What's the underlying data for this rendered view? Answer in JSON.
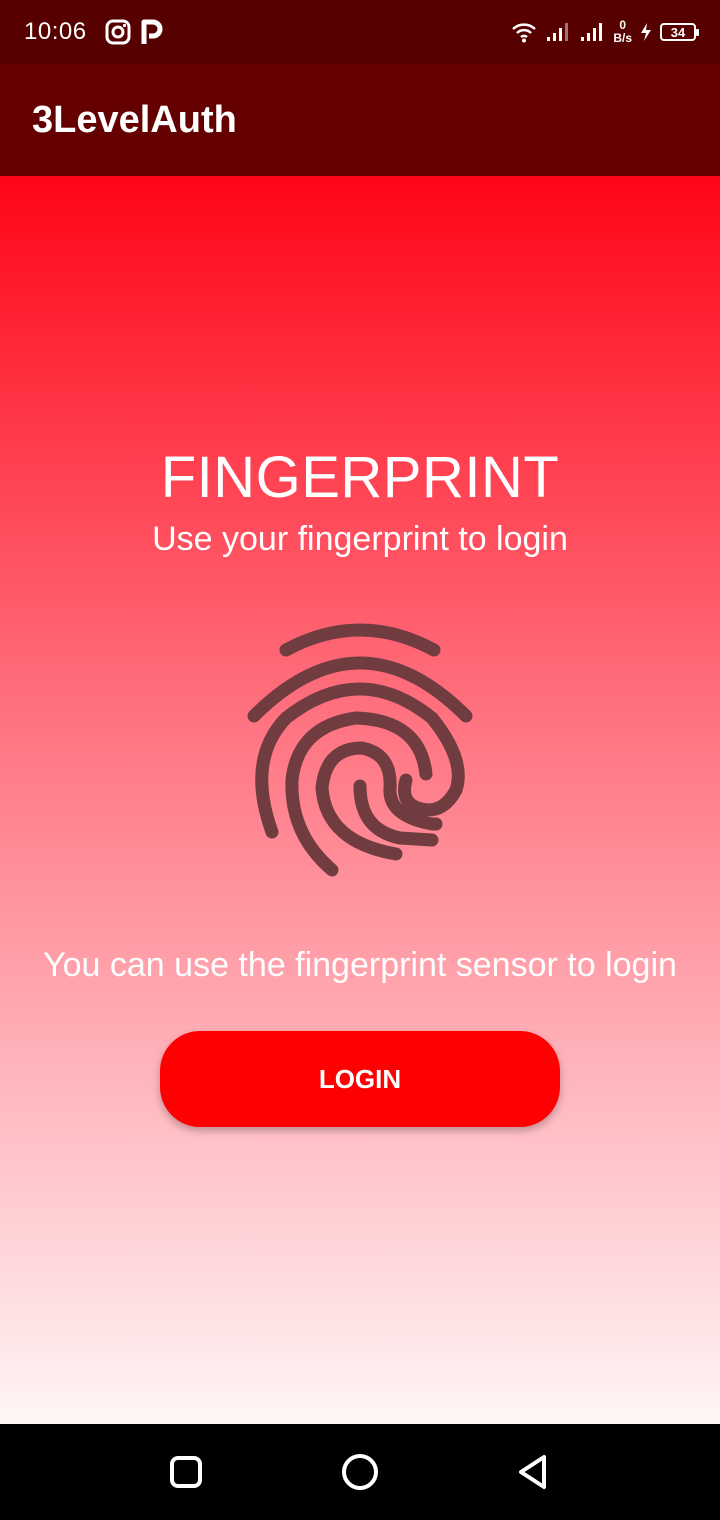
{
  "status_bar": {
    "time": "10:06",
    "left_icons": [
      "instagram-icon",
      "p-app-icon"
    ],
    "net_speed_value": "0",
    "net_speed_unit": "B/s",
    "battery_level": "34",
    "right_icons": [
      "wifi-icon",
      "signal-1-icon",
      "signal-2-icon",
      "charging-icon",
      "battery-icon"
    ]
  },
  "app_bar": {
    "title": "3LevelAuth"
  },
  "main": {
    "headline": "FINGERPRINT",
    "subhead": "Use your fingerprint to login",
    "fingerprint_icon": "fingerprint-icon",
    "hint": "You can use the fingerprint sensor to login",
    "login_label": "LOGIN"
  },
  "nav_bar": {
    "buttons": [
      "recents-button",
      "home-button",
      "back-button"
    ]
  },
  "colors": {
    "status_bar": "#560000",
    "app_bar": "#650000",
    "gradient_top": "#ff0418",
    "gradient_bottom": "#fff6f6",
    "button": "#ff0000",
    "fingerprint": "#703c40"
  }
}
